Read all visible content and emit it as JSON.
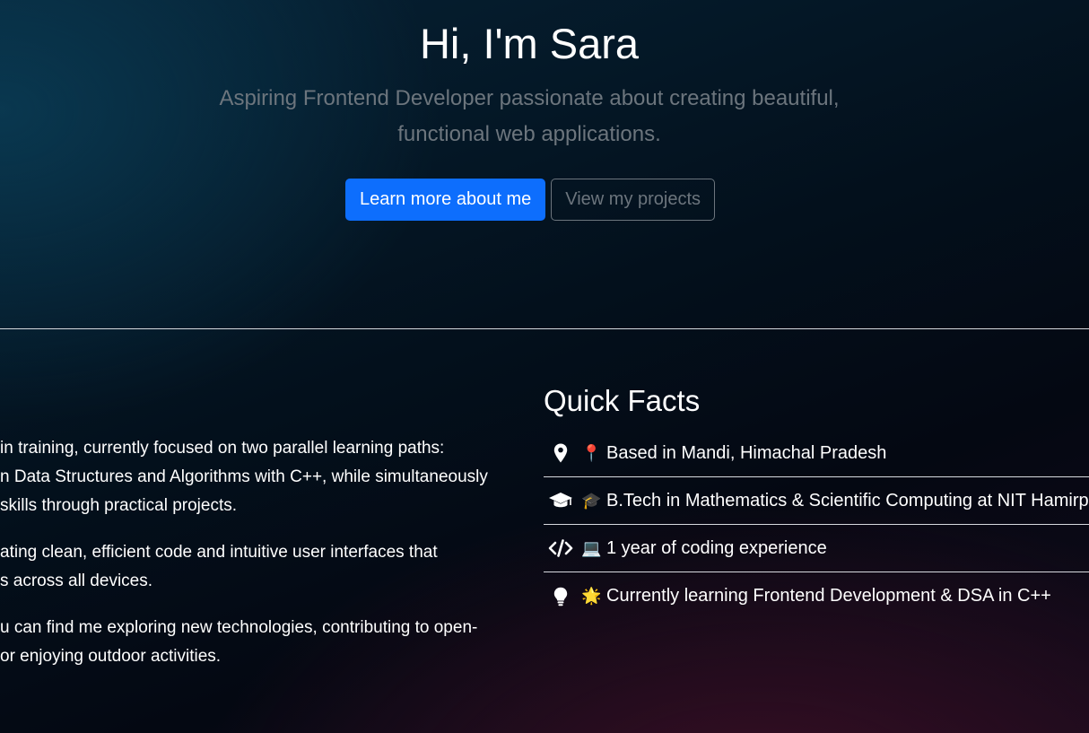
{
  "hero": {
    "title": "Hi, I'm Sara",
    "subtitle_line1": "Aspiring Frontend Developer passionate about creating beautiful,",
    "subtitle_line2": "functional web applications.",
    "primary_button": "Learn more about me",
    "secondary_button": "View my projects"
  },
  "about": {
    "paragraphs": [
      [
        "in training, currently focused on two parallel learning paths:",
        "n Data Structures and Algorithms with C++, while simultaneously",
        "skills through practical projects."
      ],
      [
        "ating clean, efficient code and intuitive user interfaces that",
        "s across all devices."
      ],
      [
        "u can find me exploring new technologies, contributing to open-",
        "or enjoying outdoor activities."
      ]
    ]
  },
  "quick_facts": {
    "title": "Quick Facts",
    "items": [
      {
        "icon": "map-marker-icon",
        "emoji": "📍",
        "text": "Based in Mandi, Himachal Pradesh"
      },
      {
        "icon": "graduation-cap-icon",
        "emoji": "🎓",
        "text": "B.Tech in Mathematics & Scientific Computing at NIT Hamirpur"
      },
      {
        "icon": "code-icon",
        "emoji": "💻",
        "text": "1 year of coding experience"
      },
      {
        "icon": "lightbulb-icon",
        "emoji": "🌟",
        "text": "Currently learning Frontend Development & DSA in C++"
      }
    ]
  },
  "colors": {
    "primary": "#0d6efd",
    "muted": "#6c757d",
    "divider": "#d6d9de"
  }
}
